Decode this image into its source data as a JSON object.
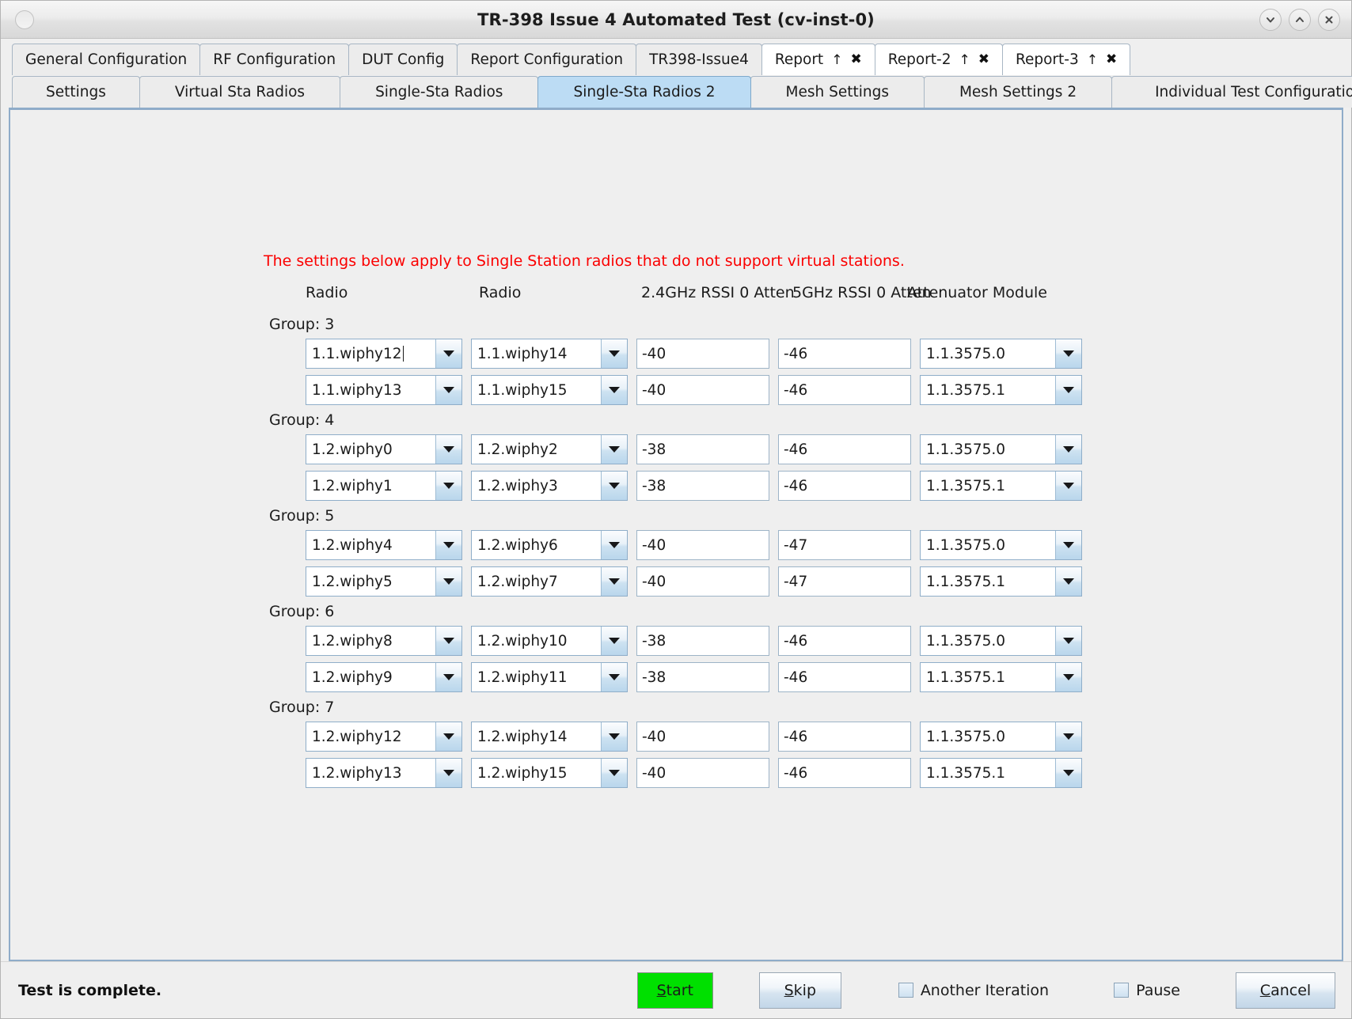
{
  "window": {
    "title": "TR-398 Issue 4 Automated Test  (cv-inst-0)",
    "buttons": {
      "minimize": "chevron-down-icon",
      "maximize": "chevron-up-icon",
      "close": "close-icon"
    }
  },
  "tabs_row1": [
    {
      "label": "General Configuration",
      "type": "plain",
      "selected": false
    },
    {
      "label": "RF Configuration",
      "type": "plain",
      "selected": false
    },
    {
      "label": "DUT Config",
      "type": "plain",
      "selected": false
    },
    {
      "label": "Report Configuration",
      "type": "plain",
      "selected": false
    },
    {
      "label": "TR398-Issue4",
      "type": "plain",
      "selected": false
    },
    {
      "label": "Report",
      "type": "report",
      "selected": false,
      "arrow": "↑",
      "close": "✖"
    },
    {
      "label": "Report-2",
      "type": "report",
      "selected": false,
      "arrow": "↑",
      "close": "✖"
    },
    {
      "label": "Report-3",
      "type": "report",
      "selected": false,
      "arrow": "↑",
      "close": "✖"
    }
  ],
  "tabs_row2": [
    {
      "label": "Settings",
      "selected": false
    },
    {
      "label": "Virtual Sta Radios",
      "selected": false
    },
    {
      "label": "Single-Sta Radios",
      "selected": false
    },
    {
      "label": "Single-Sta Radios 2",
      "selected": true
    },
    {
      "label": "Mesh Settings",
      "selected": false
    },
    {
      "label": "Mesh Settings 2",
      "selected": false
    },
    {
      "label": "Individual Test Configuration",
      "selected": false
    }
  ],
  "form": {
    "warning": "The settings below apply to Single Station radios that do not support virtual stations.",
    "headers": {
      "radio1": "Radio",
      "radio2": "Radio",
      "rssi_24": "2.4GHz RSSI 0 Atten",
      "rssi_5": "5GHz RSSI 0 Atten",
      "attenuator": "Attenuator Module"
    },
    "groups": [
      {
        "label": "Group: 3",
        "rows": [
          {
            "radio1": "1.1.wiphy12",
            "radio2": "1.1.wiphy14",
            "rssi_24": "-40",
            "rssi_5": "-46",
            "attenuator": "1.1.3575.0",
            "focused": true
          },
          {
            "radio1": "1.1.wiphy13",
            "radio2": "1.1.wiphy15",
            "rssi_24": "-40",
            "rssi_5": "-46",
            "attenuator": "1.1.3575.1",
            "focused": false
          }
        ]
      },
      {
        "label": "Group: 4",
        "rows": [
          {
            "radio1": "1.2.wiphy0",
            "radio2": "1.2.wiphy2",
            "rssi_24": "-38",
            "rssi_5": "-46",
            "attenuator": "1.1.3575.0",
            "focused": false
          },
          {
            "radio1": "1.2.wiphy1",
            "radio2": "1.2.wiphy3",
            "rssi_24": "-38",
            "rssi_5": "-46",
            "attenuator": "1.1.3575.1",
            "focused": false
          }
        ]
      },
      {
        "label": "Group: 5",
        "rows": [
          {
            "radio1": "1.2.wiphy4",
            "radio2": "1.2.wiphy6",
            "rssi_24": "-40",
            "rssi_5": "-47",
            "attenuator": "1.1.3575.0",
            "focused": false
          },
          {
            "radio1": "1.2.wiphy5",
            "radio2": "1.2.wiphy7",
            "rssi_24": "-40",
            "rssi_5": "-47",
            "attenuator": "1.1.3575.1",
            "focused": false
          }
        ]
      },
      {
        "label": "Group: 6",
        "rows": [
          {
            "radio1": "1.2.wiphy8",
            "radio2": "1.2.wiphy10",
            "rssi_24": "-38",
            "rssi_5": "-46",
            "attenuator": "1.1.3575.0",
            "focused": false
          },
          {
            "radio1": "1.2.wiphy9",
            "radio2": "1.2.wiphy11",
            "rssi_24": "-38",
            "rssi_5": "-46",
            "attenuator": "1.1.3575.1",
            "focused": false
          }
        ]
      },
      {
        "label": "Group: 7",
        "rows": [
          {
            "radio1": "1.2.wiphy12",
            "radio2": "1.2.wiphy14",
            "rssi_24": "-40",
            "rssi_5": "-46",
            "attenuator": "1.1.3575.0",
            "focused": false
          },
          {
            "radio1": "1.2.wiphy13",
            "radio2": "1.2.wiphy15",
            "rssi_24": "-40",
            "rssi_5": "-46",
            "attenuator": "1.1.3575.1",
            "focused": false
          }
        ]
      }
    ]
  },
  "statusbar": {
    "status_text": "Test is complete.",
    "start_label": "Start",
    "start_mnemonic": "S",
    "skip_label": "Skip",
    "skip_mnemonic": "S",
    "another_iteration_label": "Another Iteration",
    "another_iteration_checked": false,
    "pause_label": "Pause",
    "pause_checked": false,
    "cancel_label": "Cancel",
    "cancel_mnemonic": "C"
  },
  "colors": {
    "warning_red": "#fb0000",
    "start_green": "#00e000",
    "selected_tab_blue": "#bcdcf4",
    "panel_border_blue": "#8facc9"
  }
}
